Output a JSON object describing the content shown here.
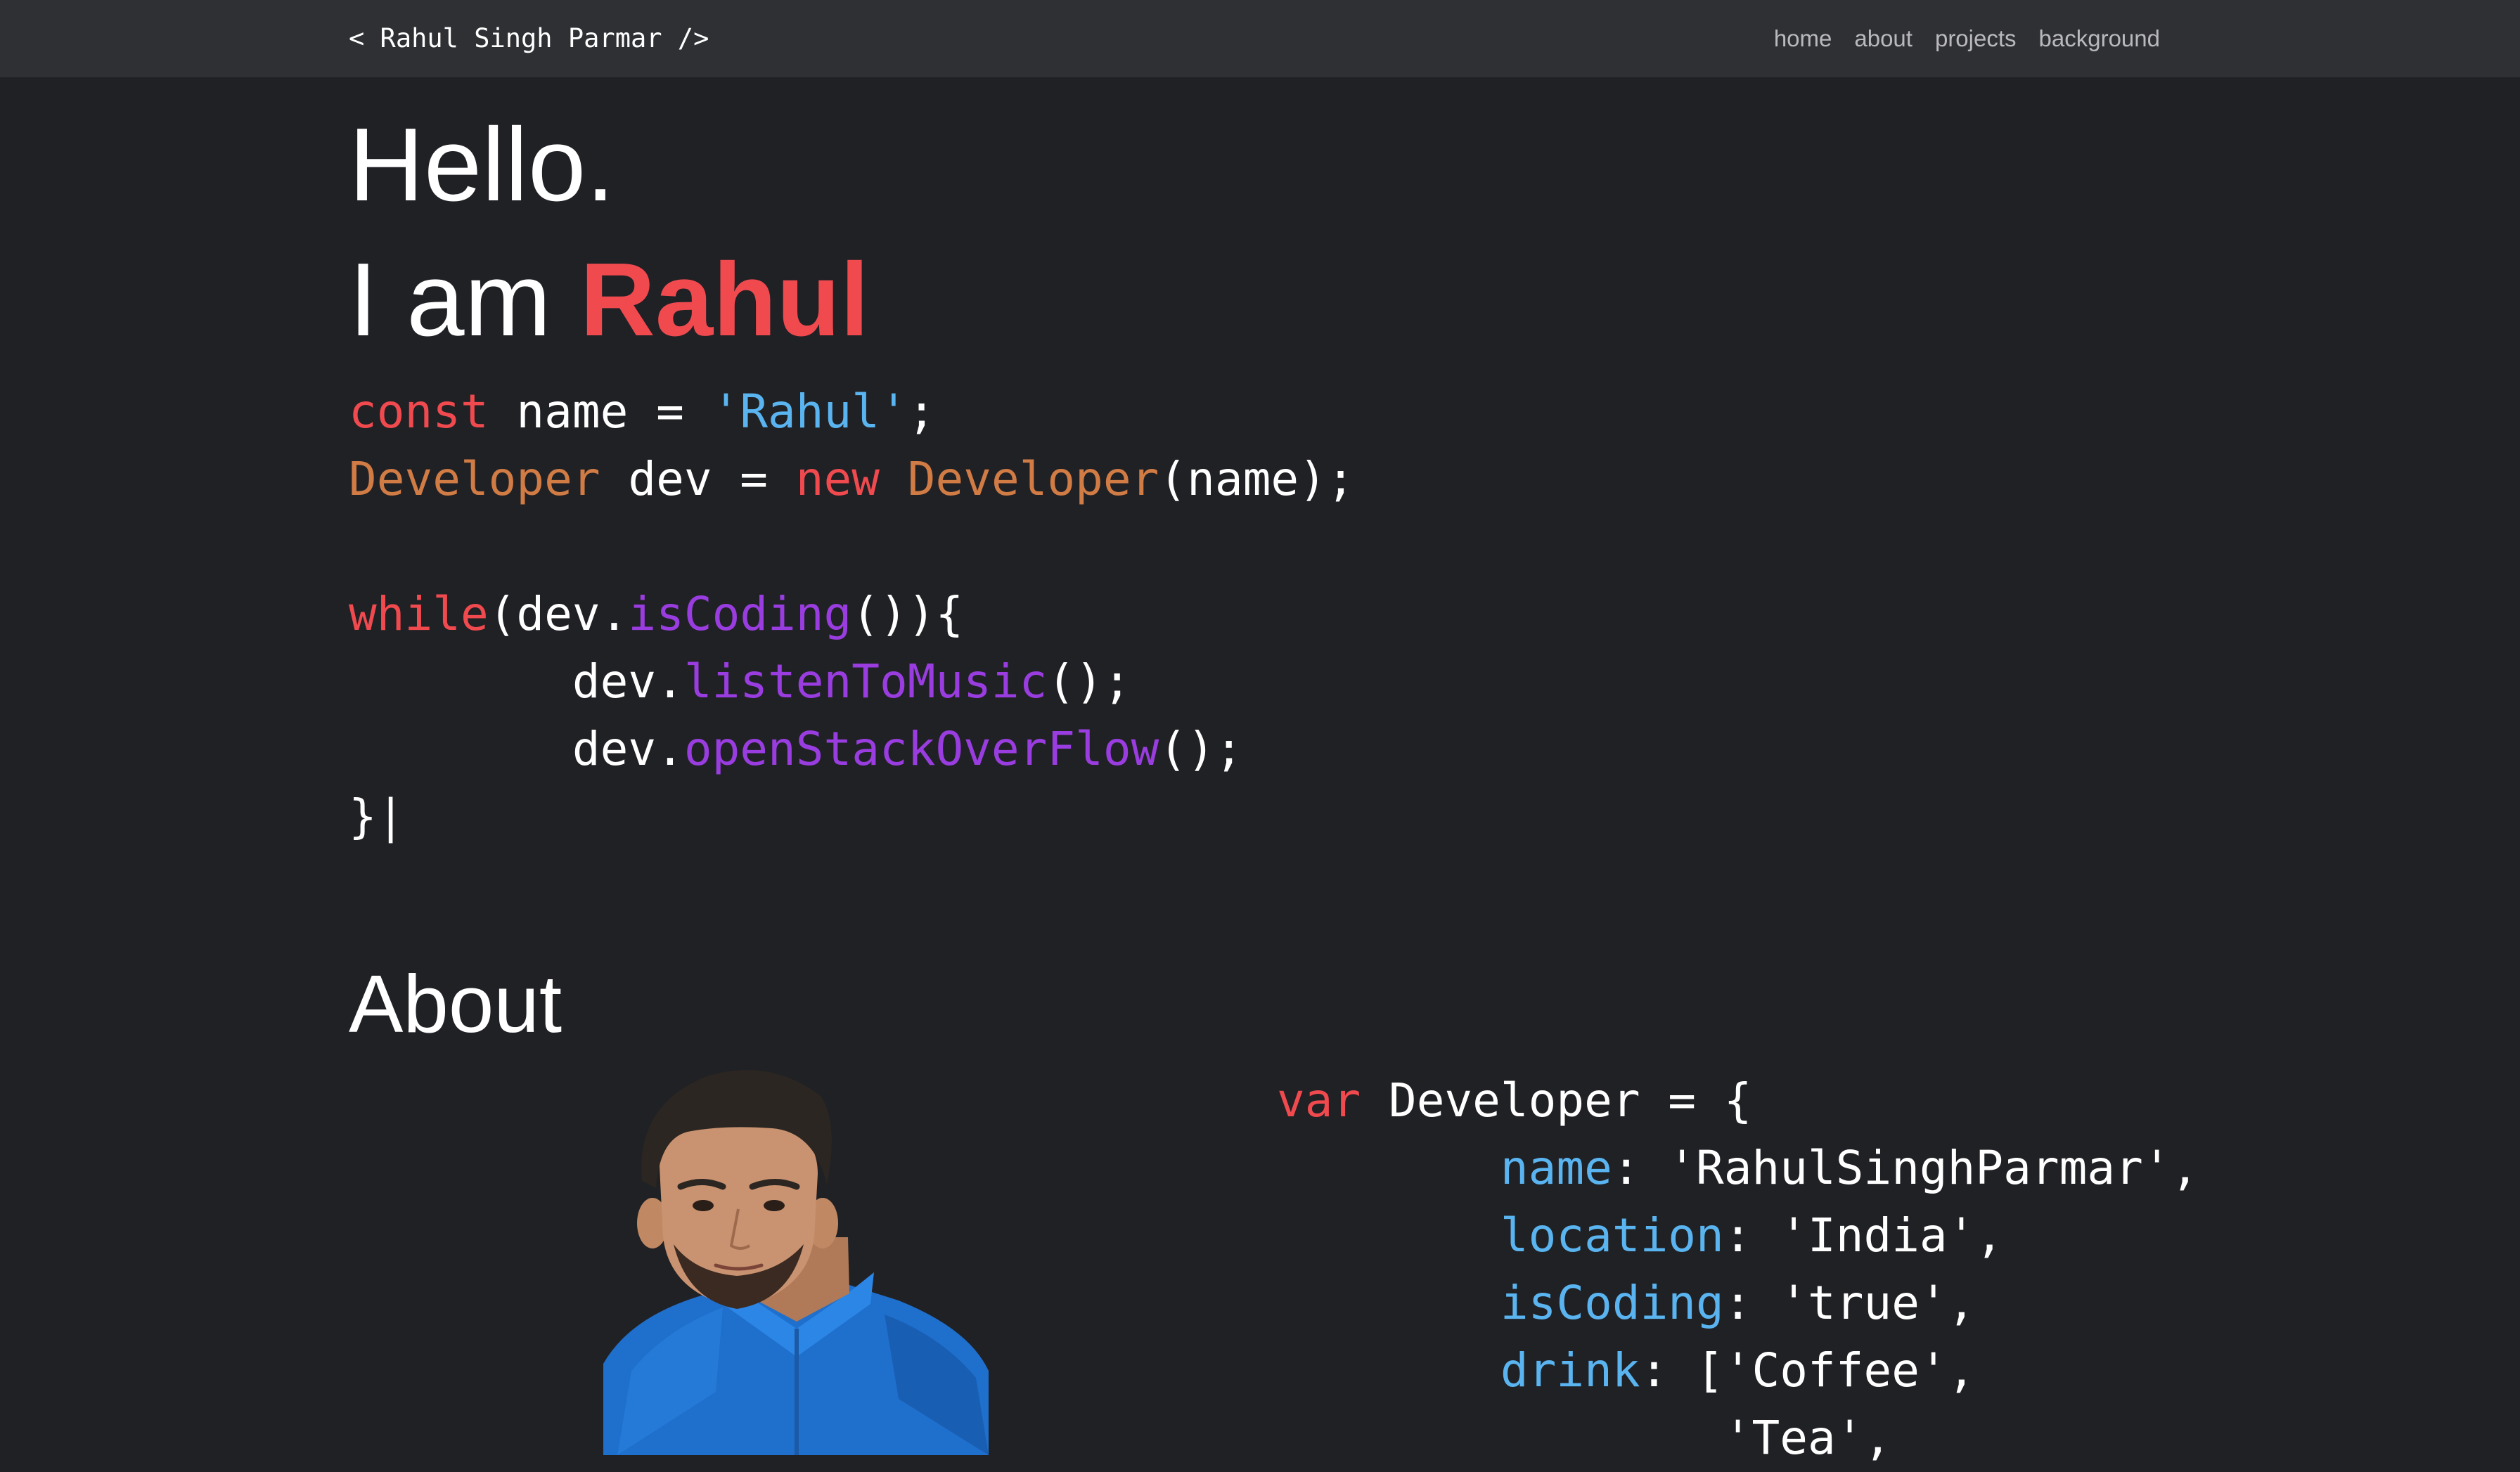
{
  "nav": {
    "brand": "< Rahul Singh Parmar />",
    "links": [
      "home",
      "about",
      "projects",
      "background"
    ]
  },
  "hero": {
    "greeting": "Hello.",
    "intro_prefix": "I am ",
    "intro_name": "Rahul"
  },
  "code_intro": {
    "line1": {
      "kw": "const",
      "rest": " name = ",
      "str": "'Rahul'",
      "end": ";"
    },
    "line2": {
      "cls1": "Developer",
      "mid": " dev = ",
      "kw": "new",
      "space": " ",
      "cls2": "Developer",
      "end": "(name);"
    },
    "line4": {
      "kw": "while",
      "pre": "(dev.",
      "fn": "isCoding",
      "end": "()){"
    },
    "line5": {
      "pre": "        dev.",
      "fn": "listenToMusic",
      "end": "();"
    },
    "line6": {
      "pre": "        dev.",
      "fn": "openStackOverFlow",
      "end": "();"
    },
    "line7": "}|"
  },
  "about": {
    "title": "About",
    "photo_alt": "Rahul Singh Parmar portrait",
    "code": {
      "line1": {
        "kw": "var",
        "rest": " Developer = {"
      },
      "line2": {
        "indent": "        ",
        "prop": "name",
        "rest": ": 'RahulSinghParmar',"
      },
      "line3": {
        "indent": "        ",
        "prop": "location",
        "rest": ": 'India',"
      },
      "line4": {
        "indent": "        ",
        "prop": "isCoding",
        "rest": ": 'true',"
      },
      "line5": {
        "indent": "        ",
        "prop": "drink",
        "rest": ": ['Coffee',"
      },
      "line6": "                'Tea',"
    }
  },
  "colors": {
    "background": "#202125",
    "navbar": "#2f3034",
    "accent": "#f04a4f",
    "class": "#d17b45",
    "string": "#5ab4f0",
    "function": "#9a3de0"
  }
}
